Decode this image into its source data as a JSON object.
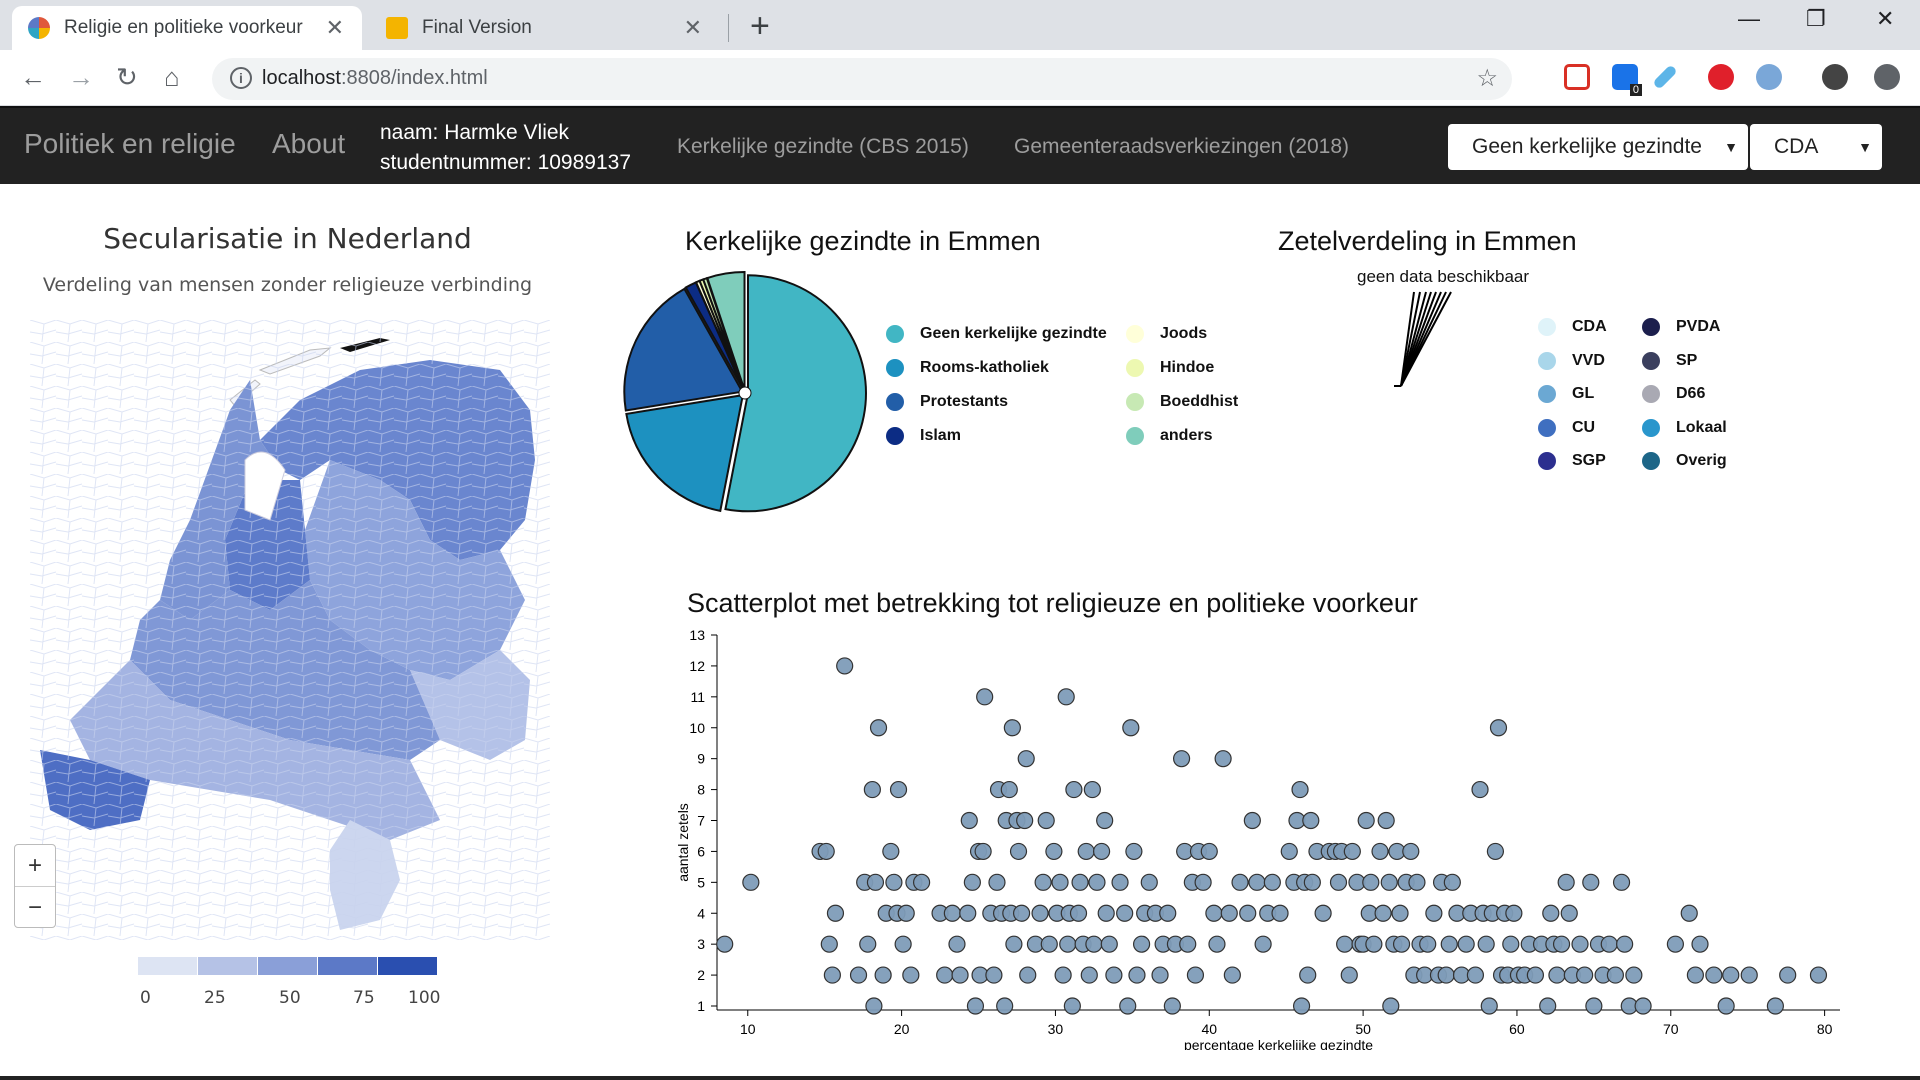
{
  "browser": {
    "tabs": [
      {
        "title": "Religie en politieke voorkeur"
      },
      {
        "title": "Final Version"
      }
    ],
    "url_host": "localhost",
    "url_rest": ":8808/index.html",
    "extension_badge": "0"
  },
  "navbar": {
    "brand": "Politiek en religie",
    "about": "About",
    "student_name": "naam: Harmke Vliek",
    "student_number": "studentnummer: 10989137",
    "link_cbs": "Kerkelijke gezindte (CBS 2015)",
    "link_gr": "Gemeenteraadsverkiezingen (2018)",
    "select_religion": "Geen kerkelijke gezindte",
    "select_party": "CDA"
  },
  "map": {
    "title": "Secularisatie in Nederland",
    "subtitle": "Verdeling van mensen zonder religieuze verbinding",
    "zoom_in": "+",
    "zoom_out": "−",
    "legend_ticks": [
      "0",
      "25",
      "50",
      "75",
      "100"
    ],
    "legend_colors": [
      "#dde4f3",
      "#b5c2e6",
      "#8a9fd8",
      "#5c79c7",
      "#2a4fb0"
    ]
  },
  "pie": {
    "title": "Kerkelijke gezindte in Emmen",
    "legend": [
      {
        "label": "Geen kerkelijke gezindte",
        "color": "#41b6c4"
      },
      {
        "label": "Rooms-katholiek",
        "color": "#1d91c0"
      },
      {
        "label": "Protestants",
        "color": "#225ea8"
      },
      {
        "label": "Islam",
        "color": "#0c2c84"
      },
      {
        "label": "Joods",
        "color": "#ffffd9"
      },
      {
        "label": "Hindoe",
        "color": "#edf8b1"
      },
      {
        "label": "Boeddhist",
        "color": "#c7e9b4"
      },
      {
        "label": "anders",
        "color": "#7fcdbb"
      }
    ],
    "values": [
      52,
      19,
      19,
      1.5,
      0.5,
      0.5,
      0.5,
      5
    ]
  },
  "seats": {
    "title": "Zetelverdeling in Emmen",
    "note": "geen data beschikbaar",
    "legend": [
      {
        "label": "CDA",
        "color": "#dff3f9"
      },
      {
        "label": "VVD",
        "color": "#a9d6ea"
      },
      {
        "label": "GL",
        "color": "#6ba8d3"
      },
      {
        "label": "CU",
        "color": "#3f6fc0"
      },
      {
        "label": "SGP",
        "color": "#2c2f8f"
      },
      {
        "label": "PVDA",
        "color": "#1c1f4d"
      },
      {
        "label": "SP",
        "color": "#3b3f5e"
      },
      {
        "label": "D66",
        "color": "#a9a9b3"
      },
      {
        "label": "Lokaal",
        "color": "#2996cc"
      },
      {
        "label": "Overig",
        "color": "#1d6688"
      }
    ]
  },
  "chart_data": {
    "type": "scatter",
    "title": "Scatterplot met betrekking tot religieuze en politieke voorkeur",
    "xlabel": "percentage kerkelijke gezindte",
    "ylabel": "aantal zetels",
    "xlim": [
      8,
      81
    ],
    "ylim": [
      1,
      13
    ],
    "x_ticks": [
      "10",
      "20",
      "30",
      "40",
      "50",
      "60",
      "70",
      "80"
    ],
    "y_ticks": [
      "1",
      "2",
      "3",
      "4",
      "5",
      "6",
      "7",
      "8",
      "9",
      "10",
      "11",
      "12",
      "13"
    ],
    "points": [
      [
        8.5,
        3
      ],
      [
        10.2,
        5
      ],
      [
        14.7,
        6
      ],
      [
        15.1,
        6
      ],
      [
        15.3,
        3
      ],
      [
        15.5,
        2
      ],
      [
        15.7,
        4
      ],
      [
        16.3,
        12
      ],
      [
        17.2,
        2
      ],
      [
        17.6,
        5
      ],
      [
        17.8,
        3
      ],
      [
        18.1,
        8
      ],
      [
        18.2,
        1
      ],
      [
        18.5,
        10
      ],
      [
        18.3,
        5
      ],
      [
        18.8,
        2
      ],
      [
        19,
        4
      ],
      [
        19.3,
        6
      ],
      [
        19.5,
        5
      ],
      [
        19.7,
        4
      ],
      [
        19.8,
        8
      ],
      [
        20.1,
        3
      ],
      [
        20.3,
        4
      ],
      [
        20.6,
        2
      ],
      [
        20.8,
        5
      ],
      [
        21.3,
        5
      ],
      [
        22.5,
        4
      ],
      [
        22.8,
        2
      ],
      [
        23.3,
        4
      ],
      [
        23.6,
        3
      ],
      [
        23.8,
        2
      ],
      [
        24.3,
        4
      ],
      [
        24.4,
        7
      ],
      [
        24.6,
        5
      ],
      [
        24.8,
        1
      ],
      [
        25,
        6
      ],
      [
        25.1,
        2
      ],
      [
        25.3,
        6
      ],
      [
        25.4,
        11
      ],
      [
        25.8,
        4
      ],
      [
        26,
        2
      ],
      [
        26.2,
        5
      ],
      [
        26.3,
        8
      ],
      [
        26.5,
        4
      ],
      [
        26.7,
        1
      ],
      [
        26.8,
        7
      ],
      [
        27,
        8
      ],
      [
        27.1,
        4
      ],
      [
        27.2,
        10
      ],
      [
        27.3,
        3
      ],
      [
        27.5,
        7
      ],
      [
        27.6,
        6
      ],
      [
        27.8,
        4
      ],
      [
        28,
        7
      ],
      [
        28.1,
        9
      ],
      [
        28.2,
        2
      ],
      [
        28.7,
        3
      ],
      [
        29,
        4
      ],
      [
        29.2,
        5
      ],
      [
        29.4,
        7
      ],
      [
        29.6,
        3
      ],
      [
        29.9,
        6
      ],
      [
        30.1,
        4
      ],
      [
        30.3,
        5
      ],
      [
        30.5,
        2
      ],
      [
        30.7,
        11
      ],
      [
        30.8,
        3
      ],
      [
        30.9,
        4
      ],
      [
        31.1,
        1
      ],
      [
        31.2,
        8
      ],
      [
        31.5,
        4
      ],
      [
        31.6,
        5
      ],
      [
        31.8,
        3
      ],
      [
        32,
        6
      ],
      [
        32.2,
        2
      ],
      [
        32.4,
        8
      ],
      [
        32.5,
        3
      ],
      [
        32.7,
        5
      ],
      [
        33,
        6
      ],
      [
        33.2,
        7
      ],
      [
        33.3,
        4
      ],
      [
        33.5,
        3
      ],
      [
        33.8,
        2
      ],
      [
        34.2,
        5
      ],
      [
        34.5,
        4
      ],
      [
        34.7,
        1
      ],
      [
        34.9,
        10
      ],
      [
        35.1,
        6
      ],
      [
        35.3,
        2
      ],
      [
        35.6,
        3
      ],
      [
        35.8,
        4
      ],
      [
        36.1,
        5
      ],
      [
        36.5,
        4
      ],
      [
        36.8,
        2
      ],
      [
        37,
        3
      ],
      [
        37.3,
        4
      ],
      [
        37.6,
        1
      ],
      [
        37.8,
        3
      ],
      [
        38.2,
        9
      ],
      [
        38.4,
        6
      ],
      [
        38.6,
        3
      ],
      [
        38.9,
        5
      ],
      [
        39.1,
        2
      ],
      [
        39.3,
        6
      ],
      [
        39.6,
        5
      ],
      [
        40,
        6
      ],
      [
        40.3,
        4
      ],
      [
        40.5,
        3
      ],
      [
        40.9,
        9
      ],
      [
        41.3,
        4
      ],
      [
        41.5,
        2
      ],
      [
        42,
        5
      ],
      [
        42.5,
        4
      ],
      [
        42.8,
        7
      ],
      [
        43.1,
        5
      ],
      [
        43.5,
        3
      ],
      [
        43.8,
        4
      ],
      [
        44.1,
        5
      ],
      [
        44.6,
        4
      ],
      [
        45.2,
        6
      ],
      [
        45.5,
        5
      ],
      [
        45.7,
        7
      ],
      [
        45.9,
        8
      ],
      [
        46,
        1
      ],
      [
        46.2,
        5
      ],
      [
        46.4,
        2
      ],
      [
        46.6,
        7
      ],
      [
        46.7,
        5
      ],
      [
        47,
        6
      ],
      [
        47.4,
        4
      ],
      [
        47.8,
        6
      ],
      [
        48.2,
        6
      ],
      [
        48.4,
        5
      ],
      [
        48.6,
        6
      ],
      [
        48.8,
        3
      ],
      [
        49.1,
        2
      ],
      [
        49.3,
        6
      ],
      [
        49.6,
        5
      ],
      [
        49.8,
        3
      ],
      [
        50,
        3
      ],
      [
        50.2,
        7
      ],
      [
        50.4,
        4
      ],
      [
        50.5,
        5
      ],
      [
        50.7,
        3
      ],
      [
        51.1,
        6
      ],
      [
        51.3,
        4
      ],
      [
        51.5,
        7
      ],
      [
        51.7,
        5
      ],
      [
        51.8,
        1
      ],
      [
        52,
        3
      ],
      [
        52.2,
        6
      ],
      [
        52.4,
        4
      ],
      [
        52.5,
        3
      ],
      [
        52.8,
        5
      ],
      [
        53.1,
        6
      ],
      [
        53.3,
        2
      ],
      [
        53.5,
        5
      ],
      [
        53.7,
        3
      ],
      [
        54,
        2
      ],
      [
        54.2,
        3
      ],
      [
        54.6,
        4
      ],
      [
        54.9,
        2
      ],
      [
        55.1,
        5
      ],
      [
        55.4,
        2
      ],
      [
        55.6,
        3
      ],
      [
        55.8,
        5
      ],
      [
        56.1,
        4
      ],
      [
        56.4,
        2
      ],
      [
        56.7,
        3
      ],
      [
        57,
        4
      ],
      [
        57.3,
        2
      ],
      [
        57.6,
        8
      ],
      [
        57.8,
        4
      ],
      [
        58,
        3
      ],
      [
        58.2,
        1
      ],
      [
        58.4,
        4
      ],
      [
        58.6,
        6
      ],
      [
        58.8,
        10
      ],
      [
        59,
        2
      ],
      [
        59.2,
        4
      ],
      [
        59.4,
        2
      ],
      [
        59.6,
        3
      ],
      [
        59.8,
        4
      ],
      [
        60.1,
        2
      ],
      [
        60.5,
        2
      ],
      [
        60.8,
        3
      ],
      [
        61.2,
        2
      ],
      [
        61.6,
        3
      ],
      [
        62,
        1
      ],
      [
        62.2,
        4
      ],
      [
        62.4,
        3
      ],
      [
        62.6,
        2
      ],
      [
        62.9,
        3
      ],
      [
        63.2,
        5
      ],
      [
        63.4,
        4
      ],
      [
        63.6,
        2
      ],
      [
        64.1,
        3
      ],
      [
        64.4,
        2
      ],
      [
        64.8,
        5
      ],
      [
        65,
        1
      ],
      [
        65.3,
        3
      ],
      [
        65.6,
        2
      ],
      [
        66,
        3
      ],
      [
        66.4,
        2
      ],
      [
        66.8,
        5
      ],
      [
        67,
        3
      ],
      [
        67.3,
        1
      ],
      [
        67.6,
        2
      ],
      [
        68.2,
        1
      ],
      [
        70.3,
        3
      ],
      [
        71.2,
        4
      ],
      [
        71.6,
        2
      ],
      [
        71.9,
        3
      ],
      [
        72.8,
        2
      ],
      [
        73.6,
        1
      ],
      [
        73.9,
        2
      ],
      [
        75.1,
        2
      ],
      [
        76.8,
        1
      ],
      [
        77.6,
        2
      ],
      [
        79.6,
        2
      ]
    ]
  }
}
